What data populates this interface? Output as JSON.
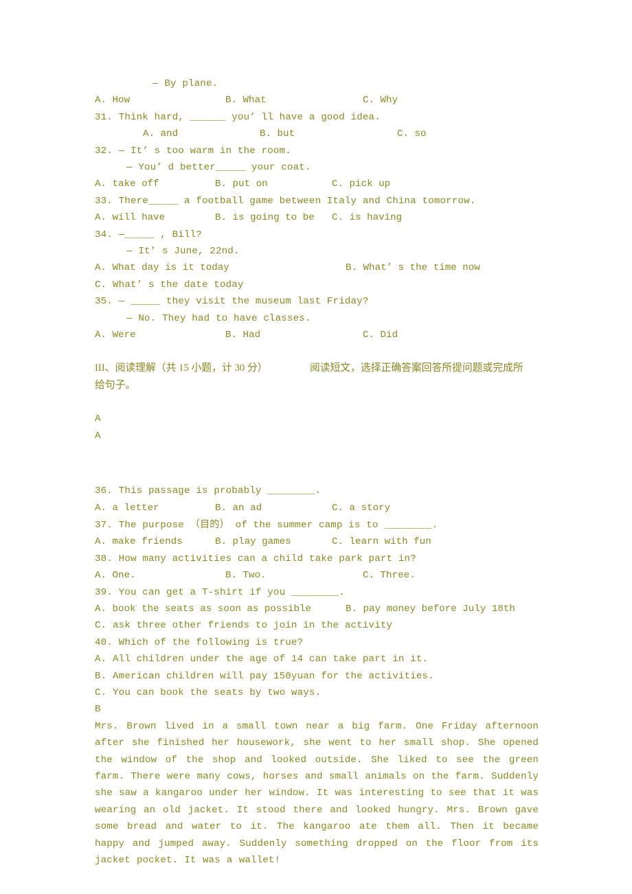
{
  "document": {
    "kind": "english-exam-paper-page",
    "text_color": "#8a8a22",
    "background_color": "#ffffff"
  },
  "section_grammar": {
    "q30_answer_line": "— By plane.",
    "q30_options": {
      "a": "A. How",
      "b": "B. What",
      "c": "C. Why"
    },
    "q31_stem": "31. Think hard, ______ you’ ll have a good idea.",
    "q31_options": {
      "a": "A. and",
      "b": "B. but",
      "c": "C. so"
    },
    "q32_stem": "32. — It’ s too warm in the room.",
    "q32_reply": "— You’ d better_____ your coat.",
    "q32_options": {
      "a": "A. take off",
      "b": "B. put on",
      "c": "C. pick up"
    },
    "q33_stem": "33. There_____ a football game between Italy and China tomorrow.",
    "q33_options": {
      "a": "A. will have",
      "b": "B. is going to be",
      "c": "C. is having"
    },
    "q34_stem": "34. —_____ , Bill?",
    "q34_reply": "— It’ s June, 22nd.",
    "q34_options": {
      "a": "A. What day is it today",
      "b": "B. What’ s the time now",
      "c": "C. What’ s the date today"
    },
    "q35_stem": "35. — _____ they visit the museum last Friday?",
    "q35_reply": "— No. They had to have classes.",
    "q35_options": {
      "a": "A. Were",
      "b": "B. Had",
      "c": "C. Did"
    }
  },
  "section_reading": {
    "header_left": "III、阅读理解（共 15 小题，计 30 分）",
    "header_right": "阅读短文，选择正确答案回答所提问题或完成所",
    "header_left_line2": "给句子。",
    "passage_a_marker_1": "A",
    "passage_a_marker_2": "A",
    "q36_stem": "36. This passage is probably ________.",
    "q36_options": {
      "a": "A. a letter",
      "b": "B. an ad",
      "c": "C. a story"
    },
    "q37_stem_pre": "37. The purpose （",
    "q37_stem_cn": "目的",
    "q37_stem_post": "） of the summer camp is to ________.",
    "q37_options": {
      "a": "A. make friends",
      "b": "B. play games",
      "c": "C. learn with fun"
    },
    "q38_stem": "38. How many activities can a child take park part in?",
    "q38_options": {
      "a": "A. One.",
      "b": "B. Two.",
      "c": "C. Three."
    },
    "q39_stem": "39. You can get a T-shirt if you ________.",
    "q39_options": {
      "a": "A. book the seats as soon as possible",
      "b": "B. pay money before July 18th",
      "c": "C. ask three other friends to join in the activity"
    },
    "q40_stem": "40. Which of the following is true?",
    "q40_options": {
      "a": "A. All children under the age of 14 can take part in it.",
      "b": "B. American children will pay 150yuan for the activities.",
      "c": "C. You can book the seats by two ways."
    },
    "passage_b_marker": "B",
    "passage_b_text": "Mrs. Brown lived in a small town near a big farm. One Friday afternoon after she finished her housework, she went to her small shop. She opened the window of the shop and looked outside. She liked to see the green farm. There were many cows, horses and small animals on the farm. Suddenly she saw a kangaroo under her window. It was interesting to see that it was wearing an old jacket. It stood there and looked hungry. Mrs. Brown gave some bread and water to it. The kangaroo ate them all. Then it became happy and jumped away. Suddenly something dropped on the floor from its jacket pocket. It was a wallet!"
  }
}
